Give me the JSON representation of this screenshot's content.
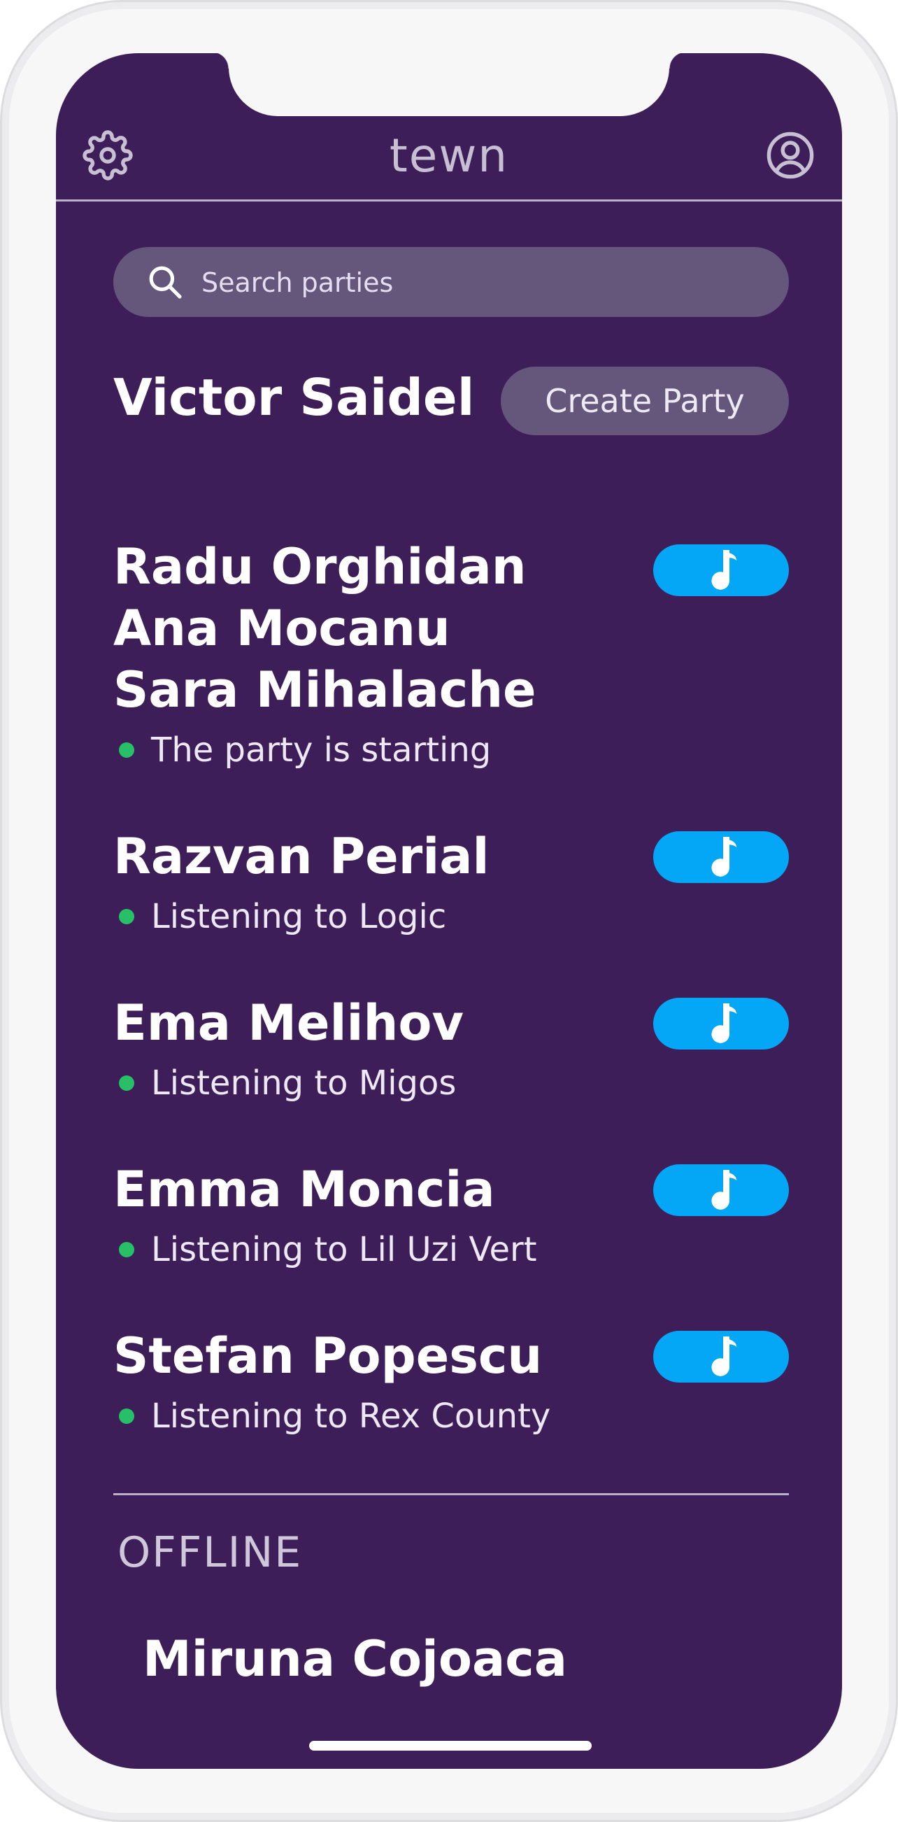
{
  "header": {
    "title": "tewn",
    "settings_icon": "gear-icon",
    "profile_icon": "user-circle-icon"
  },
  "search": {
    "placeholder": "Search parties",
    "icon": "search-icon"
  },
  "current_user": {
    "name": "Victor Saidel",
    "create_label": "Create Party"
  },
  "parties": [
    {
      "names": [
        "Radu Orghidan",
        "Ana Mocanu",
        "Sara Mihalache"
      ],
      "status": "The party is starting",
      "online": true
    },
    {
      "names": [
        "Razvan Perial"
      ],
      "status": "Listening to Logic",
      "online": true
    },
    {
      "names": [
        "Ema Melihov"
      ],
      "status": "Listening to Migos",
      "online": true
    },
    {
      "names": [
        "Emma Moncia"
      ],
      "status": "Listening to Lil Uzi Vert",
      "online": true
    },
    {
      "names": [
        "Stefan Popescu"
      ],
      "status": "Listening to Rex County",
      "online": true
    }
  ],
  "offline": {
    "label": "OFFLINE",
    "users": [
      "Miruna Cojoaca"
    ]
  },
  "colors": {
    "background": "#3e1e59",
    "accent": "#04a6f6",
    "online": "#27c066",
    "control": "#65567b"
  },
  "icons": {
    "music_button": "music-note-icon",
    "status": "online-dot-icon"
  }
}
